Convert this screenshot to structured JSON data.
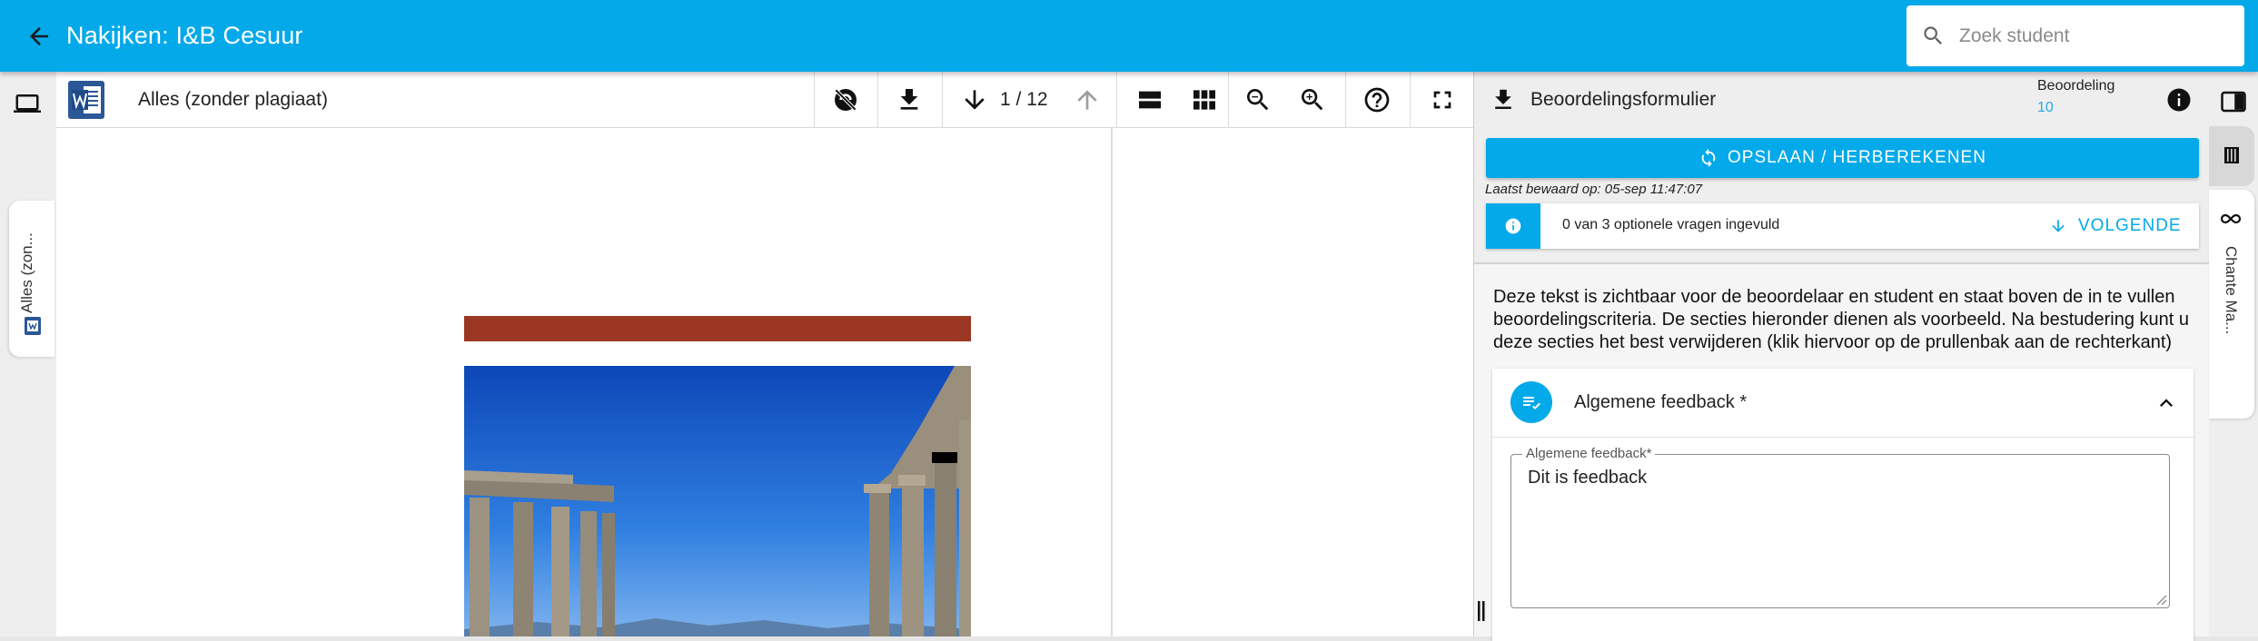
{
  "appbar": {
    "title": "Nakijken: I&B Cesuur",
    "search_placeholder": "Zoek student"
  },
  "left_rail": {
    "tab_label": "Alles (zon..."
  },
  "viewer_toolbar": {
    "document_label": "Alles (zonder plagiaat)",
    "page_indicator": "1 / 12",
    "icons": [
      "word-doc-icon",
      "hide-overlay-icon",
      "download-icon",
      "arrow-down-icon",
      "arrow-up-icon",
      "single-page-icon",
      "grid-view-icon",
      "zoom-out-icon",
      "zoom-in-icon",
      "help-icon",
      "fullscreen-icon"
    ]
  },
  "document": {
    "colors": {
      "banner": "#9b3722",
      "sky": "#1f5fc4"
    }
  },
  "right_panel": {
    "form_title": "Beoordelingsformulier",
    "grade_label": "Beoordeling",
    "grade_value": "10",
    "save_button": "OPSLAAN / HERBEREKENEN",
    "last_saved": "Laatst bewaard op: 05-sep 11:47:07",
    "info_text": "0 van 3 optionele vragen ingevuld",
    "next_button": "VOLGENDE",
    "description": "Deze tekst is zichtbaar voor de beoordelaar en student en staat boven de in te vullen beoordelingscriteria. De secties hieronder dienen als voorbeeld. Na bestudering kunt u deze secties het best verwijderen (klik hiervoor op de prullenbak aan de rechterkant)",
    "section": {
      "title": "Algemene feedback *",
      "field_label": "Algemene feedback*",
      "field_value": "Dit is feedback"
    }
  },
  "right_rail": {
    "tab_label": "Chante Ma..."
  },
  "colors": {
    "primary": "#03a9e9",
    "link": "#29a8e0"
  }
}
